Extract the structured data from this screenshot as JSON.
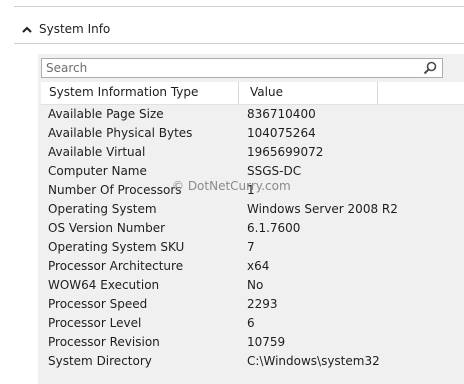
{
  "section": {
    "title": "System Info"
  },
  "search": {
    "placeholder": "Search"
  },
  "grid": {
    "columns": [
      "System Information Type",
      "Value"
    ],
    "rows": [
      [
        "Available Page Size",
        "836710400"
      ],
      [
        "Available Physical Bytes",
        "104075264"
      ],
      [
        "Available Virtual",
        "1965699072"
      ],
      [
        "Computer Name",
        "SSGS-DC"
      ],
      [
        "Number Of Processors",
        "1"
      ],
      [
        "Operating System",
        "Windows Server 2008 R2"
      ],
      [
        "OS Version Number",
        "6.1.7600"
      ],
      [
        "Operating System SKU",
        "7"
      ],
      [
        "Processor Architecture",
        "x64"
      ],
      [
        "WOW64 Execution",
        "No"
      ],
      [
        "Processor Speed",
        "2293"
      ],
      [
        "Processor Level",
        "6"
      ],
      [
        "Processor Revision",
        "10759"
      ],
      [
        "System Directory",
        "C:\\Windows\\system32"
      ]
    ]
  },
  "watermark": "© DotNetCurry.com",
  "icons": {
    "collapse": "chevron-up-icon",
    "search": "magnifier-icon"
  }
}
